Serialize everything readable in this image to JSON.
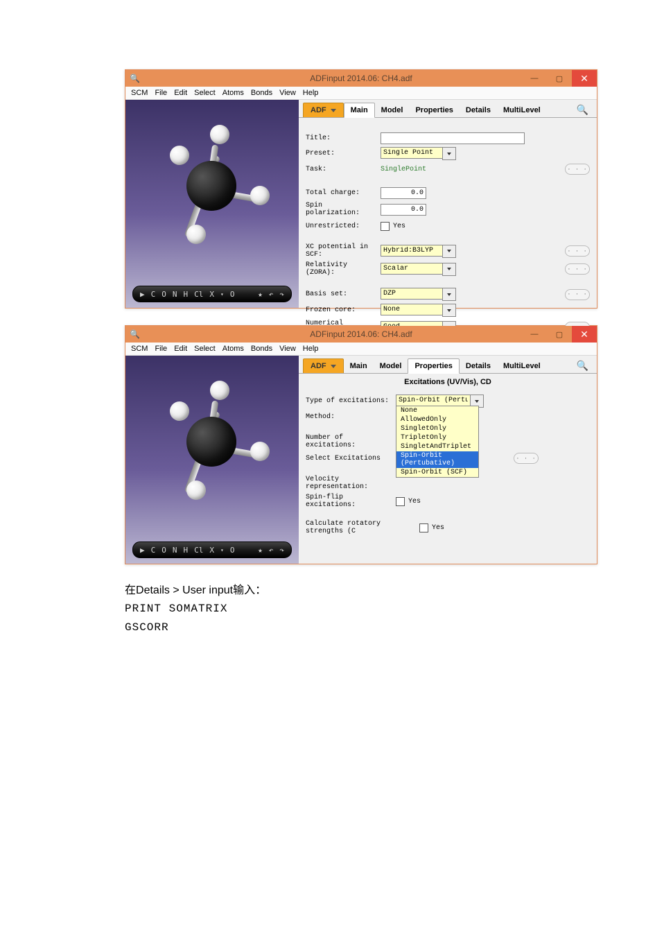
{
  "win1": {
    "title": "ADFinput 2014.06: CH4.adf",
    "menu": [
      "SCM",
      "File",
      "Edit",
      "Select",
      "Atoms",
      "Bonds",
      "View",
      "Help"
    ],
    "atombar": [
      "▶",
      "C",
      "O",
      "N",
      "H",
      "Cl",
      "X",
      "▾",
      "O"
    ],
    "atombar_right": [
      "★",
      "↶",
      "↷"
    ],
    "adf": "ADF",
    "tabs": [
      "Main",
      "Model",
      "Properties",
      "Details",
      "MultiLevel"
    ],
    "active_tab": "Main",
    "fields": {
      "title_l": "Title:",
      "preset_l": "Preset:",
      "preset_v": "Single Point",
      "task_l": "Task:",
      "task_v": "SinglePoint",
      "charge_l": "Total charge:",
      "charge_v": "0.0",
      "spin_l": "Spin polarization:",
      "spin_v": "0.0",
      "unres_l": "Unrestricted:",
      "yes": "Yes",
      "xc_l": "XC potential in SCF:",
      "xc_v": "Hybrid:B3LYP",
      "rel_l": "Relativity (ZORA):",
      "rel_v": "Scalar",
      "basis_l": "Basis set:",
      "basis_v": "DZP",
      "froz_l": "Frozen core:",
      "froz_v": "None",
      "numq_l": "Numerical quality:",
      "numq_v": "Good"
    }
  },
  "win2": {
    "title": "ADFinput 2014.06: CH4.adf",
    "menu": [
      "SCM",
      "File",
      "Edit",
      "Select",
      "Atoms",
      "Bonds",
      "View",
      "Help"
    ],
    "atombar": [
      "▶",
      "C",
      "O",
      "N",
      "H",
      "Cl",
      "X",
      "▾",
      "O"
    ],
    "atombar_right": [
      "★",
      "↶",
      "↷"
    ],
    "adf": "ADF",
    "tabs": [
      "Main",
      "Model",
      "Properties",
      "Details",
      "MultiLevel"
    ],
    "active_tab": "Properties",
    "subheader": "Excitations (UV/Vis), CD",
    "fields": {
      "type_l": "Type of excitations:",
      "type_v": "Spin-Orbit (Pertub",
      "method_l": "Method:",
      "num_l": "Number of excitations:",
      "select_l": "Select Excitations",
      "vel_l": "Velocity representation:",
      "sflip_l": "Spin-flip excitations:",
      "yes": "Yes",
      "calc_l": "Calculate rotatory strengths (C",
      "yes2": "Yes"
    },
    "dropdown": [
      "None",
      "AllowedOnly",
      "SingletOnly",
      "TripletOnly",
      "SingletAndTriplet",
      "Spin-Orbit (Pertubative)",
      "Spin-Orbit (SCF)"
    ],
    "dropdown_sel": 5
  },
  "footer": {
    "line1_pre": "在",
    "line1_mid": "Details > User input",
    "line1_post": "输入：",
    "code1": "PRINT SOMATRIX",
    "code2": "GSCORR"
  }
}
